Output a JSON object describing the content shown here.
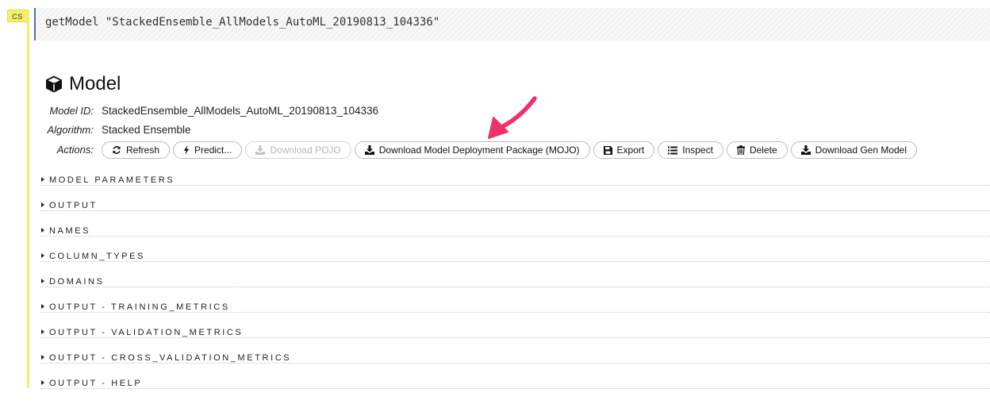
{
  "cell": {
    "badge": "CS",
    "code": "getModel \"StackedEnsemble_AllModels_AutoML_20190813_104336\""
  },
  "model": {
    "title": "Model",
    "id_label": "Model ID:",
    "id_value": "StackedEnsemble_AllModels_AutoML_20190813_104336",
    "algorithm_label": "Algorithm:",
    "algorithm_value": "Stacked Ensemble",
    "actions_label": "Actions:"
  },
  "actions": {
    "refresh": "Refresh",
    "predict": "Predict...",
    "download_pojo": "Download POJO",
    "download_mojo": "Download Model Deployment Package (MOJO)",
    "export": "Export",
    "inspect": "Inspect",
    "delete": "Delete",
    "download_gen_model": "Download Gen Model"
  },
  "sections": [
    "MODEL PARAMETERS",
    "OUTPUT",
    "NAMES",
    "COLUMN_TYPES",
    "DOMAINS",
    "OUTPUT - TRAINING_METRICS",
    "OUTPUT - VALIDATION_METRICS",
    "OUTPUT - CROSS_VALIDATION_METRICS",
    "OUTPUT - HELP"
  ],
  "colors": {
    "annotation_arrow": "#f0306a",
    "cell_bar": "#f3ec72",
    "code_border": "#4c6fb0"
  }
}
